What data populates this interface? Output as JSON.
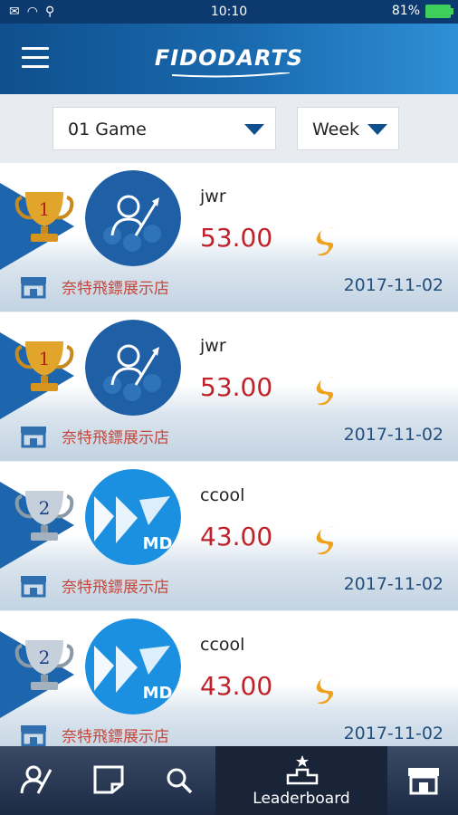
{
  "status": {
    "time": "10:10",
    "battery": "81%"
  },
  "app": {
    "logo_text": "FIDODARTS"
  },
  "filters": {
    "game": "01 Game",
    "period": "Week"
  },
  "entries": [
    {
      "rank": "1",
      "name": "jwr",
      "score": "53.00",
      "shop": "奈特飛鏢展示店",
      "date": "2017-11-02",
      "avatar": "default-user",
      "trophy_color": "gold"
    },
    {
      "rank": "1",
      "name": "jwr",
      "score": "53.00",
      "shop": "奈特飛鏢展示店",
      "date": "2017-11-02",
      "avatar": "default-user",
      "trophy_color": "gold"
    },
    {
      "rank": "2",
      "name": "ccool",
      "score": "43.00",
      "shop": "奈特飛鏢展示店",
      "date": "2017-11-02",
      "avatar": "md-logo",
      "trophy_color": "silver"
    },
    {
      "rank": "2",
      "name": "ccool",
      "score": "43.00",
      "shop": "奈特飛鏢展示店",
      "date": "2017-11-02",
      "avatar": "md-logo",
      "trophy_color": "silver"
    }
  ],
  "avatar_badge": "MD",
  "nav": {
    "items": [
      {
        "name": "profile-icon"
      },
      {
        "name": "notes-icon"
      },
      {
        "name": "search-icon"
      },
      {
        "name": "leaderboard-icon",
        "label": "Leaderboard"
      },
      {
        "name": "shop-icon"
      }
    ]
  },
  "colors": {
    "primary": "#0f4f8d",
    "score": "#c0222a",
    "shop_text": "#c4473b",
    "date": "#24507e"
  }
}
